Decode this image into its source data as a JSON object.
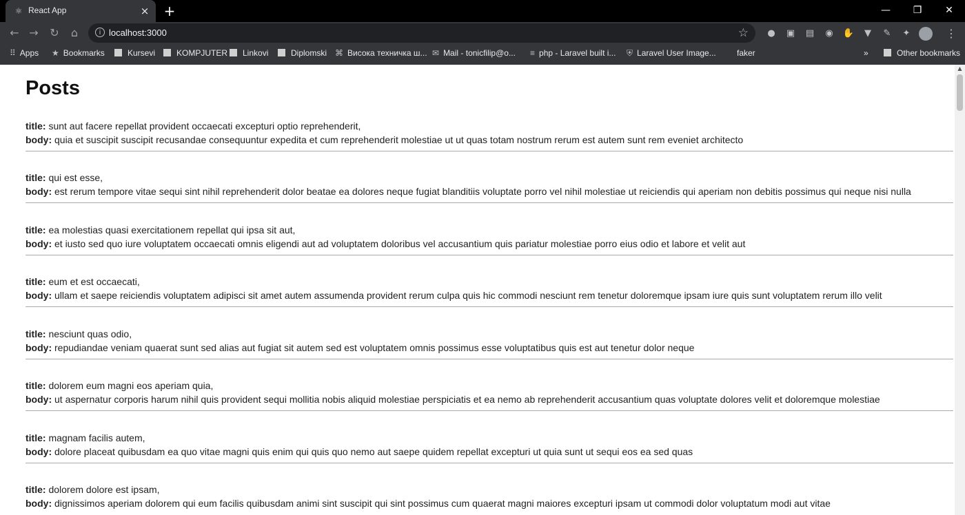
{
  "browser": {
    "tab_title": "React App",
    "new_tab_symbol": "+",
    "url": "localhost:3000",
    "bookmarks": [
      "Apps",
      "Bookmarks",
      "Kursevi",
      "KOMPJUTER",
      "Linkovi",
      "Diplomski",
      "Висока техничка ш...",
      "Mail - tonicfilip@o...",
      "php - Laravel built i...",
      "Laravel User Image...",
      "faker",
      "»",
      "Other bookmarks"
    ]
  },
  "page": {
    "title": "Posts",
    "title_label": "title:",
    "body_label": "body:",
    "posts": [
      {
        "title": "sunt aut facere repellat provident occaecati excepturi optio reprehenderit,",
        "body": "quia et suscipit suscipit recusandae consequuntur expedita et cum reprehenderit molestiae ut ut quas totam nostrum rerum est autem sunt rem eveniet architecto"
      },
      {
        "title": "qui est esse,",
        "body": "est rerum tempore vitae sequi sint nihil reprehenderit dolor beatae ea dolores neque fugiat blanditiis voluptate porro vel nihil molestiae ut reiciendis qui aperiam non debitis possimus qui neque nisi nulla"
      },
      {
        "title": "ea molestias quasi exercitationem repellat qui ipsa sit aut,",
        "body": "et iusto sed quo iure voluptatem occaecati omnis eligendi aut ad voluptatem doloribus vel accusantium quis pariatur molestiae porro eius odio et labore et velit aut"
      },
      {
        "title": "eum et est occaecati,",
        "body": "ullam et saepe reiciendis voluptatem adipisci sit amet autem assumenda provident rerum culpa quis hic commodi nesciunt rem tenetur doloremque ipsam iure quis sunt voluptatem rerum illo velit"
      },
      {
        "title": "nesciunt quas odio,",
        "body": "repudiandae veniam quaerat sunt sed alias aut fugiat sit autem sed est voluptatem omnis possimus esse voluptatibus quis est aut tenetur dolor neque"
      },
      {
        "title": "dolorem eum magni eos aperiam quia,",
        "body": "ut aspernatur corporis harum nihil quis provident sequi mollitia nobis aliquid molestiae perspiciatis et ea nemo ab reprehenderit accusantium quas voluptate dolores velit et doloremque molestiae"
      },
      {
        "title": "magnam facilis autem,",
        "body": "dolore placeat quibusdam ea quo vitae magni quis enim qui quis quo nemo aut saepe quidem repellat excepturi ut quia sunt ut sequi eos ea sed quas"
      },
      {
        "title": "dolorem dolore est ipsam,",
        "body": "dignissimos aperiam dolorem qui eum facilis quibusdam animi sint suscipit qui sint possimus cum quaerat magni maiores excepturi ipsam ut commodi dolor voluptatum modi aut vitae"
      }
    ]
  }
}
